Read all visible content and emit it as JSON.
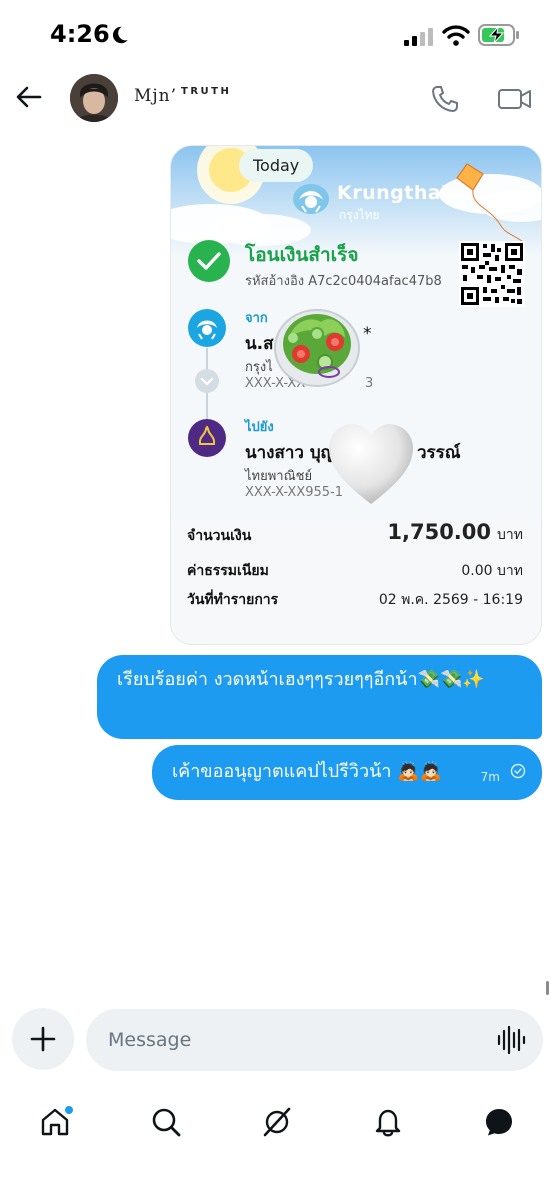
{
  "status_bar": {
    "time": "4:26"
  },
  "header": {
    "name": "Mjn’",
    "name_suffix": "TRUTH"
  },
  "receipt": {
    "date_badge": "Today",
    "bank_name": "Krungthai",
    "bank_name_thai": "กรุงไทย",
    "title": "โอนเงินสำเร็จ",
    "reference": "รหัสอ้างอิง A7c2c0404afac47b8",
    "from_label": "จาก",
    "from_name": "น.ส",
    "from_name_tail": "*",
    "from_bank": "กรุงไ",
    "from_account": "XXX-X-XX",
    "from_account_tail": "3",
    "to_label": "ไปยัง",
    "to_name": "นางสาว บุญ",
    "to_name_tail": "วรรณ์",
    "to_bank": "ไทยพาณิชย์",
    "to_account": "XXX-X-XX955-1",
    "amount_label": "จำนวนเงิน",
    "amount_value": "1,750.00",
    "amount_unit": "บาท",
    "fee_label": "ค่าธรรมเนียม",
    "fee_value": "0.00 บาท",
    "date_label": "วันที่ทำรายการ",
    "date_value": "02 พ.ค. 2569 - 16:19"
  },
  "messages": [
    {
      "text": "เรียบร้อยค่า งวดหน้าเฮงๆๆรวยๆๆอีกน้า💸💸✨"
    },
    {
      "text": "เค้าขออนุญาตแคปไปรีวิวน้า 🙇🏻🙇🏻",
      "time": "7m"
    }
  ],
  "composer": {
    "placeholder": "Message"
  },
  "colors": {
    "accent": "#1d9bf0",
    "success": "#19a24b",
    "krungthai": "#1a9ad6",
    "scb_purple": "#4e2a84"
  },
  "icons": {
    "status": [
      "moon-icon",
      "signal-icon",
      "wifi-icon",
      "battery-charging-icon"
    ],
    "header": [
      "back-arrow-icon",
      "phone-icon",
      "video-icon"
    ],
    "nav": [
      "home-icon",
      "search-icon",
      "grok-icon",
      "bell-icon",
      "messages-icon"
    ]
  }
}
